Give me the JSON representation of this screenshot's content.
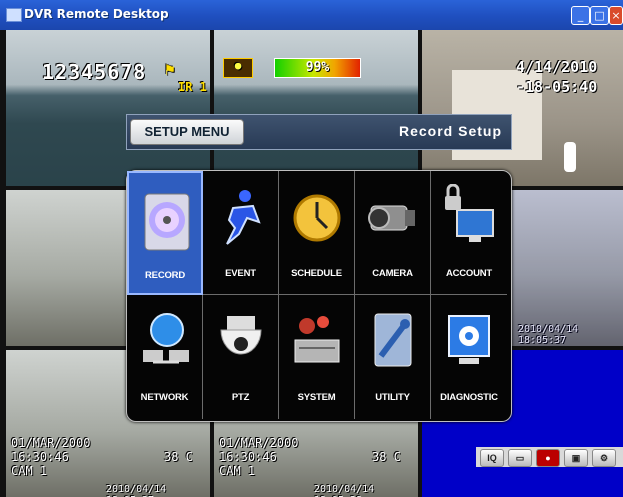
{
  "window": {
    "title": "DVR Remote Desktop"
  },
  "osd": {
    "camera_id": "12345678",
    "ir_label": "IR 1",
    "disk_percent": "99%",
    "disk_level": 0.99,
    "date": "4/14/2010",
    "time": "-18-05:40",
    "cam1_stamp": "2010/04/14 18:05:37",
    "cam2_stamp": "2010/04/14 18:05:38",
    "cam3_stamp": "2010/04/14 18:05:37",
    "cam_date": "01/MAR/2000",
    "cam_time": "16:30:46",
    "cam_name": "CAM 1",
    "temperature": "38 C"
  },
  "setup": {
    "menu_label": "SETUP MENU",
    "page_title": "Record Setup",
    "items": [
      {
        "label": "RECORD",
        "icon": "record-disc-icon"
      },
      {
        "label": "EVENT",
        "icon": "running-man-icon"
      },
      {
        "label": "SCHEDULE",
        "icon": "clock-icon"
      },
      {
        "label": "CAMERA",
        "icon": "camera-icon"
      },
      {
        "label": "ACCOUNT",
        "icon": "lock-monitor-icon"
      },
      {
        "label": "NETWORK",
        "icon": "globe-network-icon"
      },
      {
        "label": "PTZ",
        "icon": "dome-camera-icon"
      },
      {
        "label": "SYSTEM",
        "icon": "system-gears-icon"
      },
      {
        "label": "UTILITY",
        "icon": "wrench-icon"
      },
      {
        "label": "DIAGNOSTIC",
        "icon": "diagnostic-gear-icon"
      }
    ]
  },
  "tray": {
    "iq_label": "IQ"
  },
  "colors": {
    "title_bar": "#2a63d8",
    "menu_bg": "#050505",
    "selected_bg": "#2f5dbf",
    "blue_channel": "#0000c8"
  }
}
